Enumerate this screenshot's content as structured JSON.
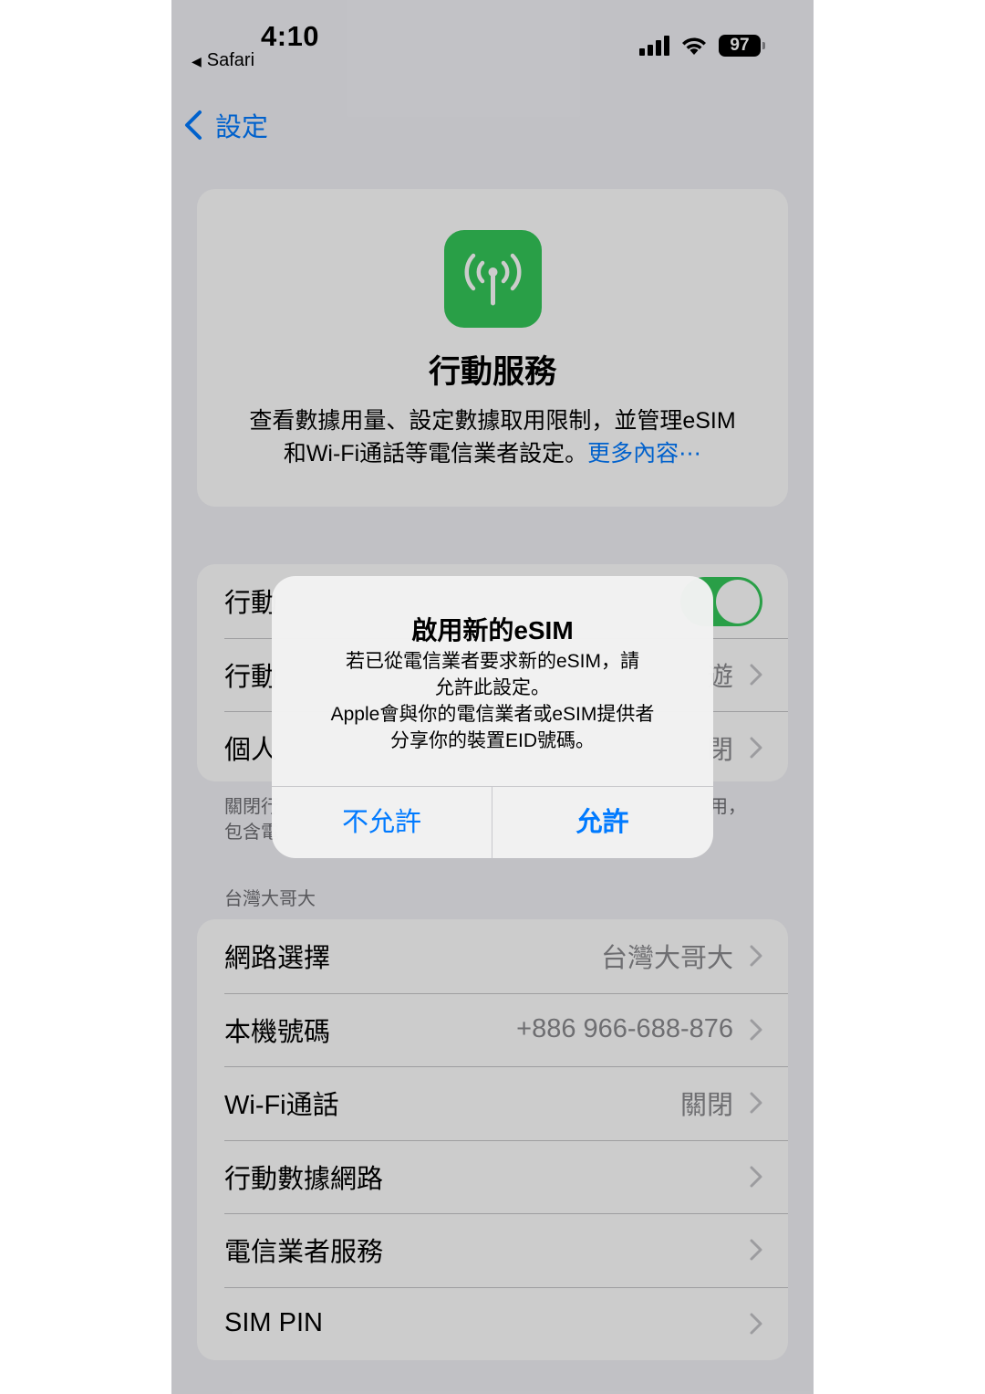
{
  "status_bar": {
    "time": "4:10",
    "back_app": "Safari",
    "battery": "97"
  },
  "nav": {
    "back_label": "設定"
  },
  "header": {
    "title": "行動服務",
    "description_line1": "查看數據用量、設定數據取用限制，並管理eSIM",
    "description_line2": "和Wi-Fi通話等電信業者設定。",
    "more_link": "更多內容⋯"
  },
  "top_group": {
    "rows": [
      {
        "label": "行動",
        "value": ""
      },
      {
        "label": "行動",
        "value": "遊"
      },
      {
        "label": "個人",
        "value": "閉"
      }
    ]
  },
  "footer_note": {
    "line1": "關閉行",
    "line1_tail": "用，",
    "line2": "包含電"
  },
  "carrier_section": {
    "header": "台灣大哥大",
    "rows": [
      {
        "label": "網路選擇",
        "value": "台灣大哥大"
      },
      {
        "label": "本機號碼",
        "value": "+886 966-688-876"
      },
      {
        "label": "Wi-Fi通話",
        "value": "關閉"
      },
      {
        "label": "行動數據網路",
        "value": ""
      },
      {
        "label": "電信業者服務",
        "value": ""
      },
      {
        "label": "SIM PIN",
        "value": ""
      }
    ]
  },
  "alert": {
    "title": "啟用新的eSIM",
    "message_line1": "若已從電信業者要求新的eSIM，請",
    "message_line2": "允許此設定。",
    "message_line3": "Apple會與你的電信業者或eSIM提供者",
    "message_line4": "分享你的裝置EID號碼。",
    "deny_label": "不允許",
    "allow_label": "允許"
  },
  "colors": {
    "accent": "#007aff",
    "green": "#34c759",
    "background": "#f2f2f7"
  }
}
